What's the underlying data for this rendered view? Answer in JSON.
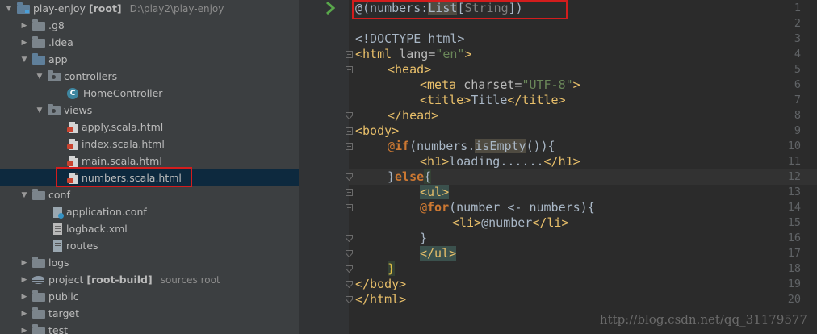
{
  "tree": {
    "root": {
      "name": "play-enjoy",
      "tag": "[root]",
      "path": "D:\\play2\\play-enjoy"
    },
    "items": [
      {
        "label": "play-enjoy",
        "bold": "[root]",
        "extra": "D:\\play2\\play-enjoy"
      },
      {
        "label": ".g8"
      },
      {
        "label": ".idea"
      },
      {
        "label": "app"
      },
      {
        "label": "controllers"
      },
      {
        "label": "HomeController"
      },
      {
        "label": "views"
      },
      {
        "label": "apply.scala.html"
      },
      {
        "label": "index.scala.html"
      },
      {
        "label": "main.scala.html"
      },
      {
        "label": "numbers.scala.html"
      },
      {
        "label": "conf"
      },
      {
        "label": "application.conf"
      },
      {
        "label": "logback.xml"
      },
      {
        "label": "routes"
      },
      {
        "label": "logs"
      },
      {
        "label": "project",
        "bold": "[root-build]",
        "extra": "sources root"
      },
      {
        "label": "public"
      },
      {
        "label": "target"
      },
      {
        "label": "test"
      }
    ]
  },
  "editor": {
    "line_numbers": [
      "1",
      "2",
      "3",
      "4",
      "5",
      "6",
      "7",
      "8",
      "9",
      "10",
      "11",
      "12",
      "13",
      "14",
      "15",
      "16",
      "17",
      "18",
      "19",
      "20"
    ],
    "code": {
      "l1_at": "@(numbers:",
      "l1_list": "List",
      "l1_br": "[",
      "l1_string": "String",
      "l1_end": "])",
      "l3": "<!DOCTYPE html>",
      "l4_open": "<html ",
      "l4_attr": "lang=",
      "l4_val": "\"en\"",
      "l4_close": ">",
      "l5": "<head>",
      "l6_open": "<meta ",
      "l6_attr": "charset=",
      "l6_val": "\"UTF-8\"",
      "l6_close": ">",
      "l7_open": "<title>",
      "l7_text": "Title",
      "l7_close": "</title>",
      "l8": "</head>",
      "l9": "<body>",
      "l10_at": "@",
      "l10_kw": "if",
      "l10_a": "(numbers.",
      "l10_m": "isEmpty",
      "l10_b": "()){",
      "l11_open": "<h1>",
      "l11_text": "loading......",
      "l11_close": "</h1>",
      "l12_a": "}",
      "l12_kw": "else",
      "l12_b": "{",
      "l13": "<ul>",
      "l14_at": "@",
      "l14_kw": "for",
      "l14_a": "(number <- numbers){",
      "l15_open": "<li>",
      "l15_text": "@number",
      "l15_close": "</li>",
      "l16": "}",
      "l17": "</ul>",
      "l18": "}",
      "l19": "</body>",
      "l20": "</html>"
    }
  },
  "watermark": "http://blog.csdn.net/qq_31179577",
  "colors": {
    "tree_bg": "#3c3f41",
    "editor_bg": "#2b2b2b",
    "tag": "#e8bf6a",
    "keyword": "#cc7832",
    "string": "#6a8759",
    "highlight_box": "#d31d1d"
  }
}
